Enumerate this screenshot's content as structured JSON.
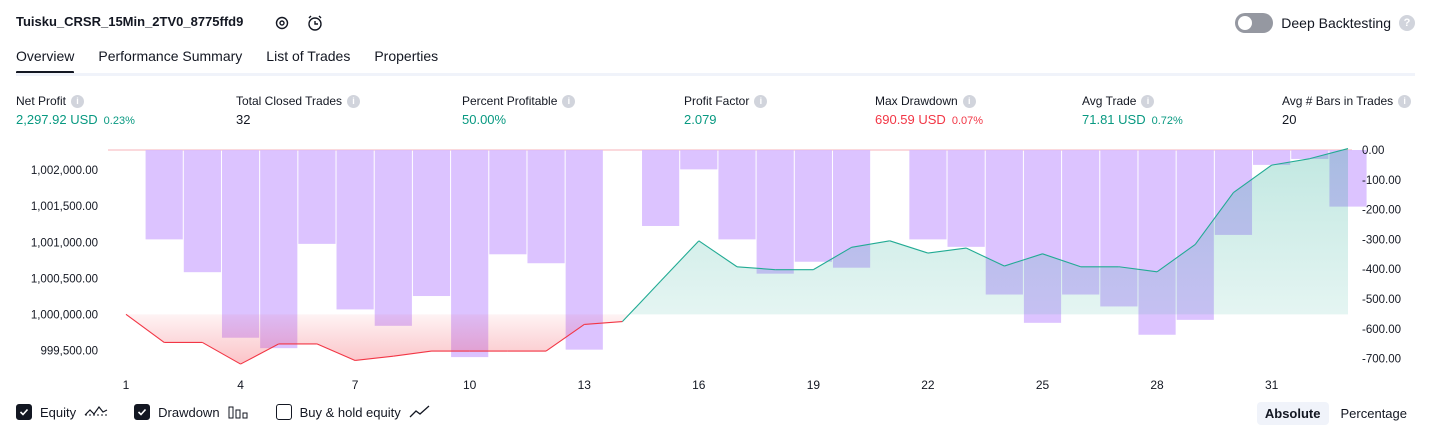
{
  "header": {
    "title": "Tuisku_CRSR_15Min_2TV0_8775ffd9",
    "deep_backtesting_label": "Deep Backtesting",
    "help_glyph": "?"
  },
  "tabs": [
    {
      "label": "Overview",
      "active": true
    },
    {
      "label": "Performance Summary",
      "active": false
    },
    {
      "label": "List of Trades",
      "active": false
    },
    {
      "label": "Properties",
      "active": false
    }
  ],
  "metrics": [
    {
      "label": "Net Profit",
      "value": "2,297.92 USD",
      "pct": "0.23%",
      "tone": "pos"
    },
    {
      "label": "Total Closed Trades",
      "value": "32",
      "pct": "",
      "tone": "neu"
    },
    {
      "label": "Percent Profitable",
      "value": "50.00%",
      "pct": "",
      "tone": "pos"
    },
    {
      "label": "Profit Factor",
      "value": "2.079",
      "pct": "",
      "tone": "pos"
    },
    {
      "label": "Max Drawdown",
      "value": "690.59 USD",
      "pct": "0.07%",
      "tone": "neg"
    },
    {
      "label": "Avg Trade",
      "value": "71.81 USD",
      "pct": "0.72%",
      "tone": "pos"
    },
    {
      "label": "Avg # Bars in Trades",
      "value": "20",
      "pct": "",
      "tone": "neu"
    }
  ],
  "chart_data": {
    "type": "bar",
    "x_ticks": [
      1,
      4,
      7,
      10,
      13,
      16,
      19,
      22,
      25,
      28,
      31
    ],
    "left_axis": {
      "ticks": [
        "1,002,000.00",
        "1,001,500.00",
        "1,001,000.00",
        "1,000,500.00",
        "1,000,000.00",
        "999,500.00"
      ],
      "values": [
        1002000,
        1001500,
        1001000,
        1000500,
        1000000,
        999500
      ],
      "range": [
        999200,
        1002280
      ]
    },
    "right_axis": {
      "ticks": [
        "0.00",
        "-100.00",
        "-200.00",
        "-300.00",
        "-400.00",
        "-500.00",
        "-600.00",
        "-700.00"
      ],
      "values": [
        0,
        -100,
        -200,
        -300,
        -400,
        -500,
        -600,
        -700
      ],
      "range": [
        -745,
        0
      ]
    },
    "series": [
      {
        "name": "Equity",
        "baseline": 1000000,
        "x": [
          1,
          2,
          3,
          4,
          5,
          6,
          7,
          8,
          9,
          10,
          11,
          12,
          13,
          14,
          15,
          16,
          17,
          18,
          19,
          20,
          21,
          22,
          23,
          24,
          25,
          26,
          27,
          28,
          29,
          30,
          31,
          32,
          33
        ],
        "values": [
          1000000,
          999610,
          999610,
          999310,
          999590,
          999590,
          999360,
          999420,
          999490,
          999490,
          999490,
          999490,
          999860,
          999900,
          1000460,
          1001020,
          1000660,
          1000620,
          1000620,
          1000930,
          1001020,
          1000850,
          1000920,
          1000670,
          1000840,
          1000660,
          1000660,
          1000590,
          1000970,
          1001690,
          1002070,
          1002160,
          1002300
        ]
      },
      {
        "name": "Drawdown",
        "x": [
          2,
          3,
          4,
          5,
          6,
          7,
          8,
          9,
          10,
          11,
          12,
          13,
          14,
          15,
          16,
          17,
          18,
          19,
          20,
          21,
          22,
          23,
          24,
          25,
          26,
          27,
          28,
          29,
          30,
          31,
          32,
          33
        ],
        "values": [
          -300,
          -410,
          -630,
          -665,
          -315,
          -535,
          -590,
          -490,
          -695,
          -350,
          -380,
          -670,
          0,
          -255,
          -65,
          -300,
          -415,
          -375,
          -395,
          0,
          -300,
          -325,
          -485,
          -580,
          -485,
          -525,
          -620,
          -570,
          -285,
          -50,
          -30,
          -190
        ]
      }
    ]
  },
  "colors": {
    "equity_line": "#22ab94",
    "equity_fill": "#22ab94",
    "loss_line": "#f23645",
    "drawdown_bar": "#d6b8ff",
    "positive": "#089981",
    "negative": "#f23645"
  },
  "legend": {
    "equity_label": "Equity",
    "drawdown_label": "Drawdown",
    "buy_hold_label": "Buy & hold equity",
    "equity_checked": true,
    "drawdown_checked": true,
    "buy_hold_checked": false
  },
  "modes": {
    "absolute": "Absolute",
    "percentage": "Percentage",
    "active": "Absolute"
  }
}
